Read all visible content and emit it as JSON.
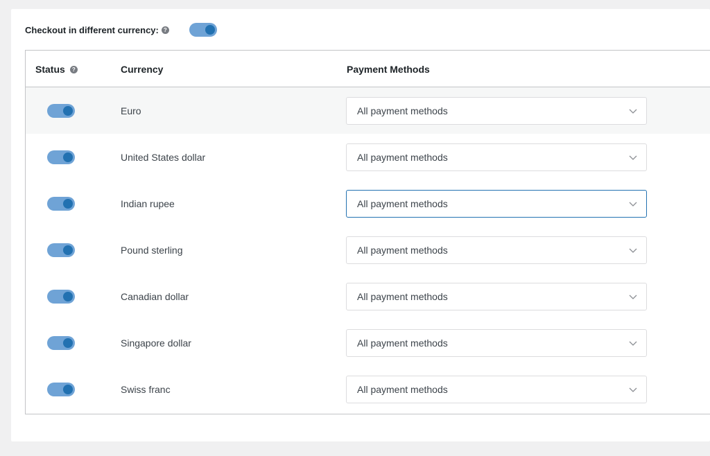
{
  "header": {
    "checkout_label": "Checkout in different currency:",
    "help_icon": "question-icon",
    "checkout_toggle_on": true
  },
  "table": {
    "columns": [
      "Status",
      "Currency",
      "Payment Methods"
    ],
    "rows": [
      {
        "enabled": true,
        "currency": "Euro",
        "payment": "All payment methods"
      },
      {
        "enabled": true,
        "currency": "United States dollar",
        "payment": "All payment methods"
      },
      {
        "enabled": true,
        "currency": "Indian rupee",
        "payment": "All payment methods"
      },
      {
        "enabled": true,
        "currency": "Pound sterling",
        "payment": "All payment methods"
      },
      {
        "enabled": true,
        "currency": "Canadian dollar",
        "payment": "All payment methods"
      },
      {
        "enabled": true,
        "currency": "Singapore dollar",
        "payment": "All payment methods"
      },
      {
        "enabled": true,
        "currency": "Swiss franc",
        "payment": "All payment methods"
      }
    ]
  },
  "colors": {
    "toggle_track": "#6fa3d6",
    "toggle_knob": "#2271b1",
    "focus_border": "#2271b1"
  }
}
